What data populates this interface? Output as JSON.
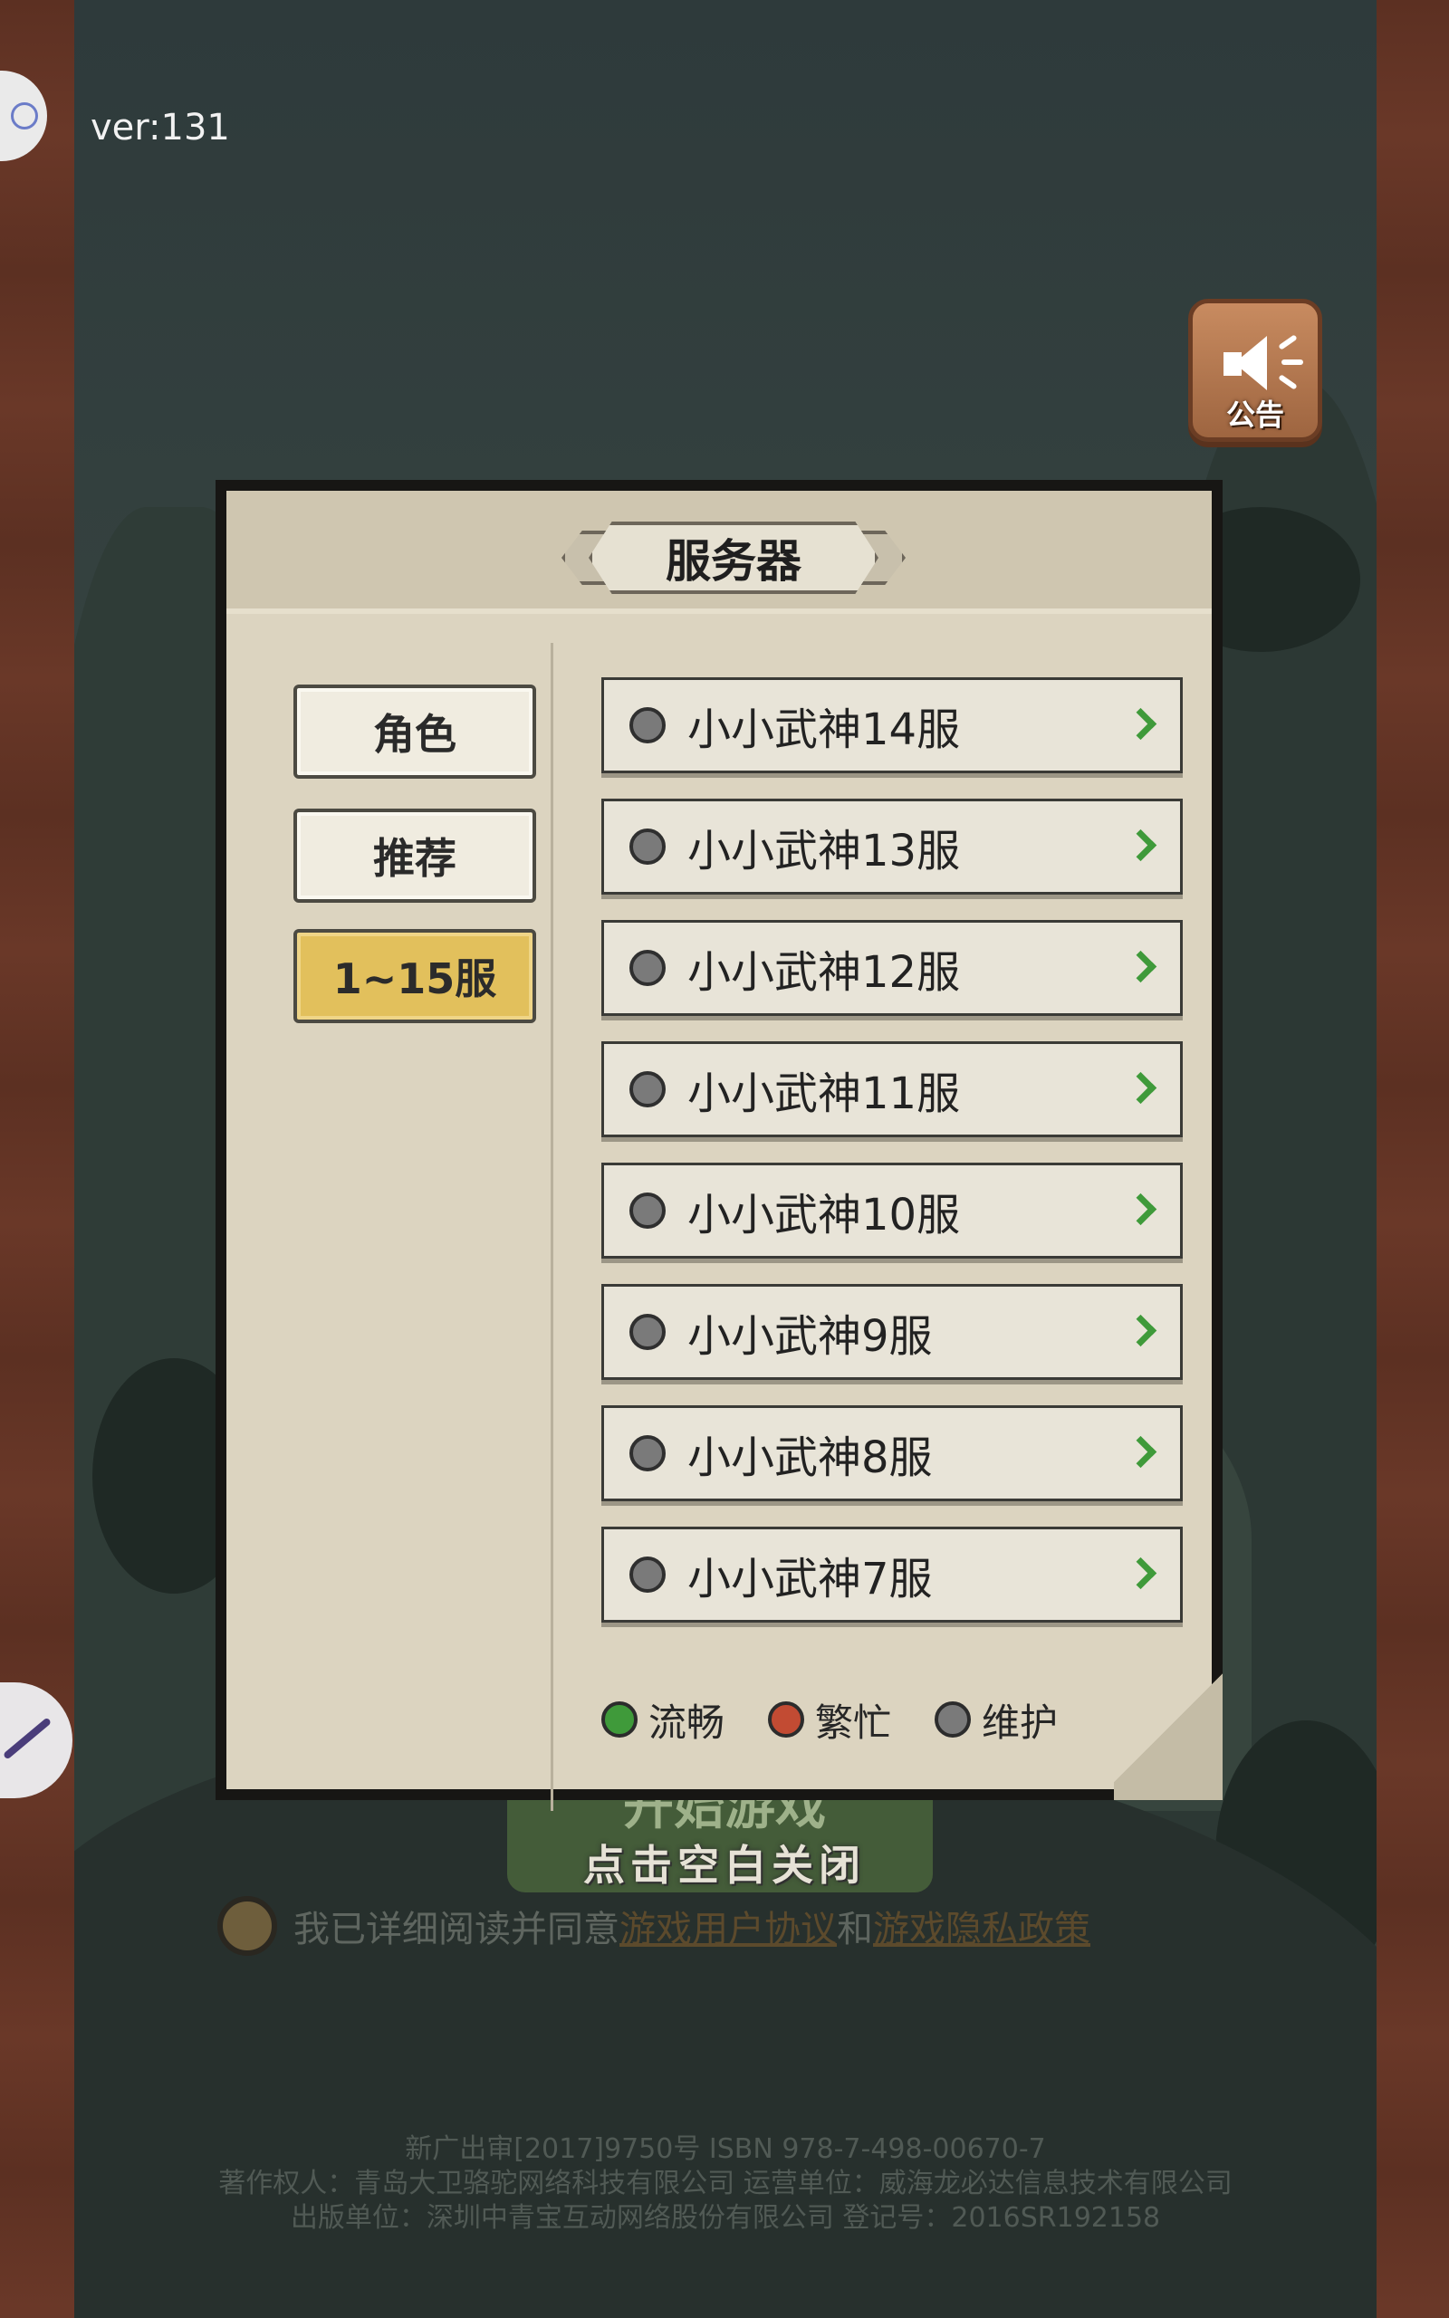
{
  "app": {
    "version": "ver:131"
  },
  "notice_button": {
    "label": "公告",
    "icon": "speaker-icon"
  },
  "dialog": {
    "title": "服务器",
    "tabs": [
      {
        "label": "角色",
        "active": false
      },
      {
        "label": "推荐",
        "active": false
      },
      {
        "label": "1~15服",
        "active": true
      }
    ],
    "servers": [
      {
        "name": "小小武神14服",
        "status": "维护"
      },
      {
        "name": "小小武神13服",
        "status": "维护"
      },
      {
        "name": "小小武神12服",
        "status": "维护"
      },
      {
        "name": "小小武神11服",
        "status": "维护"
      },
      {
        "name": "小小武神10服",
        "status": "维护"
      },
      {
        "name": "小小武神9服",
        "status": "维护"
      },
      {
        "name": "小小武神8服",
        "status": "维护"
      },
      {
        "name": "小小武神7服",
        "status": "维护"
      }
    ],
    "legend": [
      {
        "label": "流畅",
        "color": "#3f9a3a"
      },
      {
        "label": "繁忙",
        "color": "#c24b33"
      },
      {
        "label": "维护",
        "color": "#7a7a7a"
      }
    ]
  },
  "start": {
    "label": "开始游戏",
    "hint": "点击空白关闭"
  },
  "agreement": {
    "prefix": "我已详细阅读并同意",
    "link1": "游戏用户协议",
    "and": "和",
    "link2": "游戏隐私政策"
  },
  "footer": {
    "line1": "新广出审[2017]9750号   ISBN 978-7-498-00670-7",
    "line2": "著作权人：青岛大卫骆驼网络科技有限公司   运营单位：威海龙必达信息技术有限公司",
    "line3": "出版单位：深圳中青宝互动网络股份有限公司   登记号：2016SR192158"
  },
  "colors": {
    "active_tab": "#e2c05c",
    "arrow": "#3f9a3a",
    "panel": "#dcd4c0"
  }
}
